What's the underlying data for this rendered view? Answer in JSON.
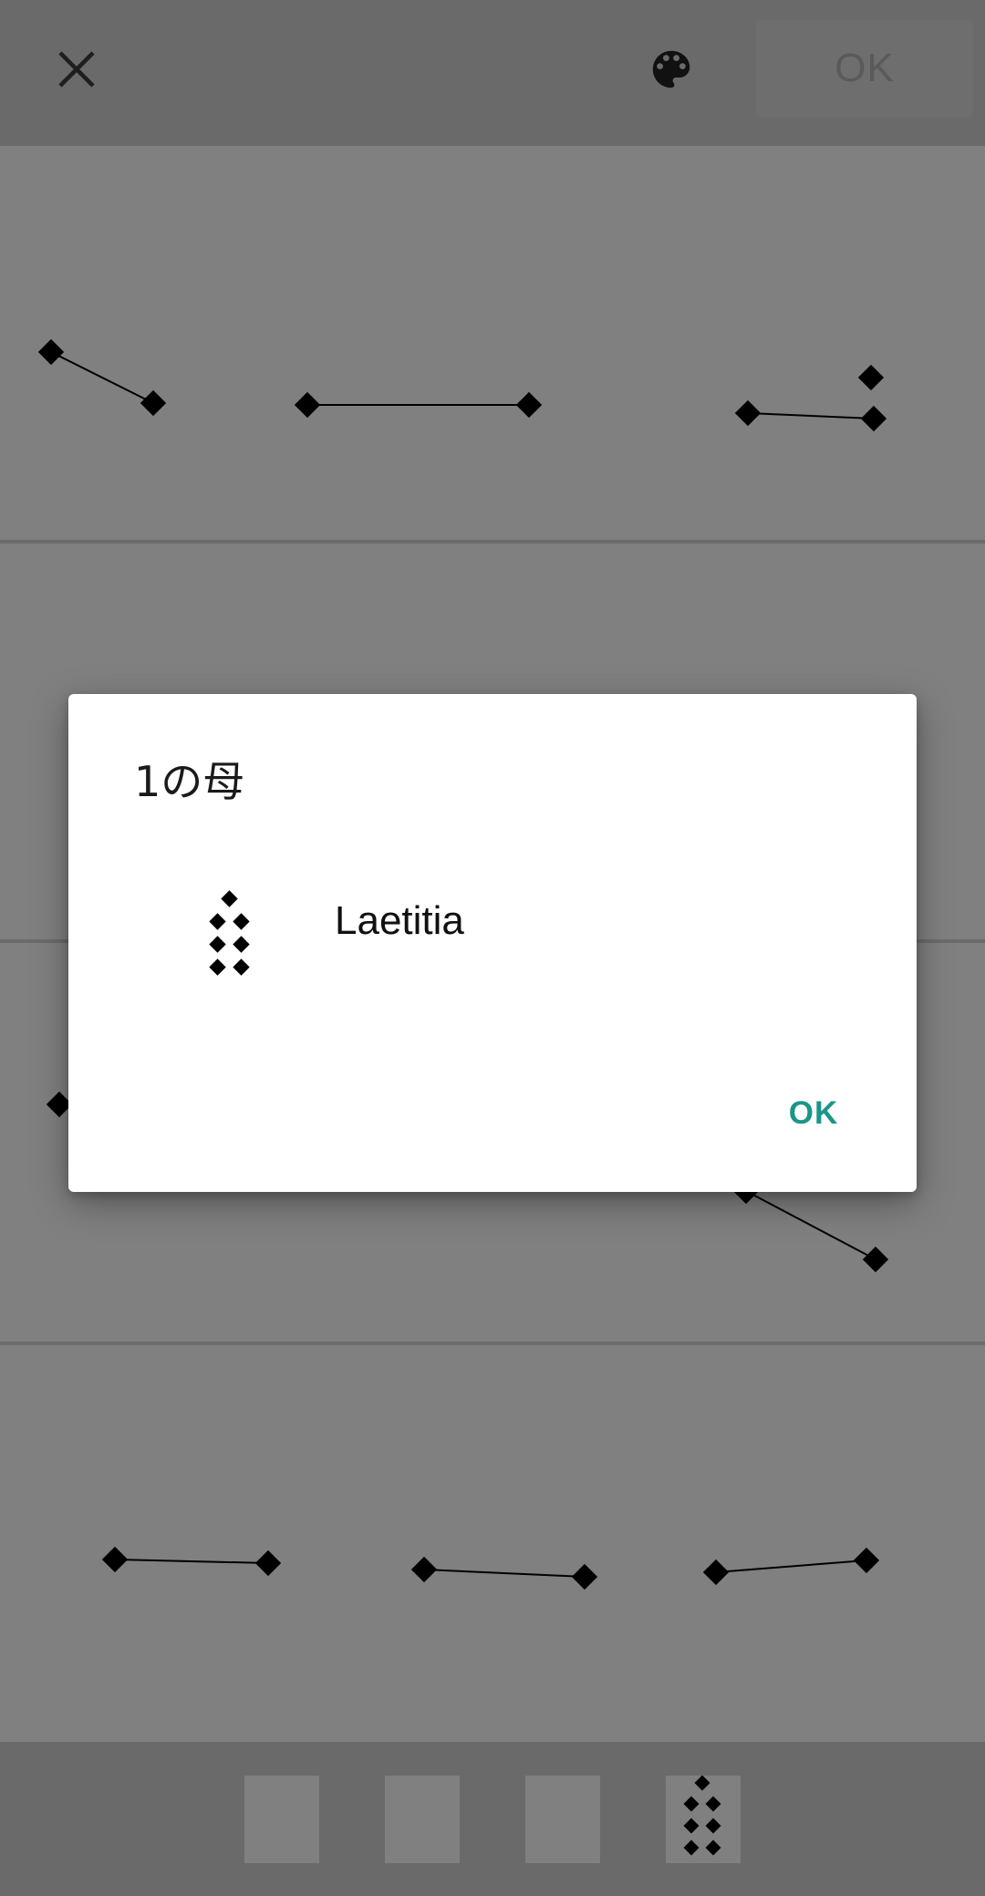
{
  "toolbar": {
    "close_icon": "close-icon",
    "palette_icon": "palette-icon",
    "ok_label": "OK"
  },
  "dialog": {
    "title": "1の母",
    "figure_name": "Laetitia",
    "ok_label": "OK"
  },
  "colors": {
    "toolbar_bg": "#6a6a6a",
    "content_bg": "#808080",
    "dialog_bg": "#ffffff",
    "dialog_ok": "#1a9688"
  }
}
